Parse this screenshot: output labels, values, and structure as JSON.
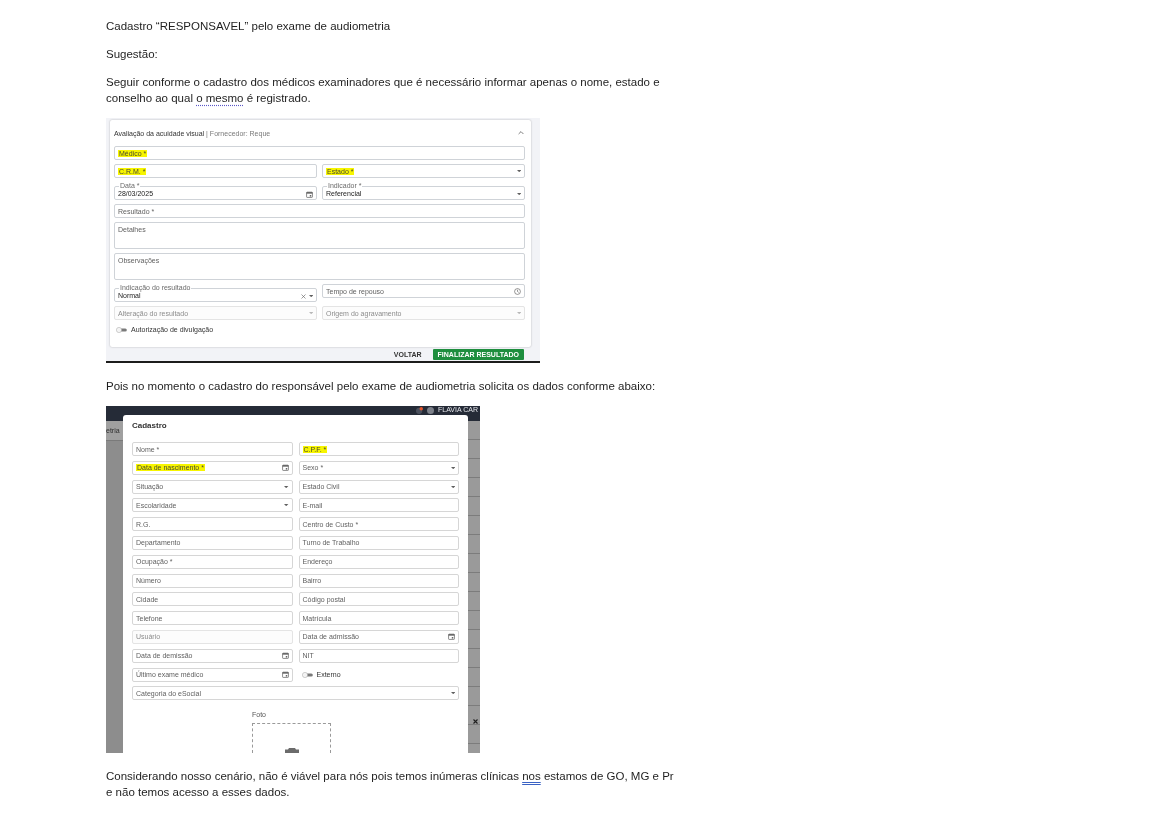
{
  "blocks": [
    {
      "kind": "paragraph",
      "segments": [
        {
          "kind": "plain",
          "text": "Cadastro “RESPONSAVEL” pelo exame de audiometria"
        }
      ]
    },
    {
      "kind": "paragraph",
      "segments": [
        {
          "kind": "plain",
          "text": "Sugestão:"
        }
      ]
    },
    {
      "kind": "paragraph",
      "segments": [
        {
          "kind": "plain",
          "text": "Seguir conforme o cadastro dos médicos examinadores que é necessário informar apenas o nome, estado e conselho ao qual "
        },
        {
          "kind": "dotted_underline",
          "text": "o mesmo"
        },
        {
          "kind": "plain",
          "text": " é registrado."
        }
      ]
    },
    {
      "kind": "exam_form_screenshot",
      "title": "Avaliação da acuidade visual",
      "subtitle": "| Fornecedor: Reque",
      "expanded": true,
      "rows": [
        {
          "fields": [
            {
              "kind": "text",
              "label": "Médico *",
              "highlighted": true,
              "disabled": false,
              "clearable": false
            }
          ]
        },
        {
          "fields": [
            {
              "kind": "text",
              "label": "C.R.M. *",
              "highlighted": true,
              "disabled": false,
              "clearable": false
            },
            {
              "kind": "select",
              "label": "Estado *",
              "highlighted": true,
              "disabled": false,
              "clearable": false
            }
          ]
        },
        {
          "fields": [
            {
              "kind": "date",
              "label": "Data *",
              "value": "28/03/2025",
              "highlighted": false,
              "disabled": false,
              "clearable": false
            },
            {
              "kind": "select",
              "label": "Indicador *",
              "value": "Referencial",
              "highlighted": false,
              "disabled": false,
              "clearable": false
            }
          ]
        },
        {
          "fields": [
            {
              "kind": "text",
              "label": "Resultado *",
              "highlighted": false,
              "disabled": false,
              "clearable": false
            }
          ]
        },
        {
          "fields": [
            {
              "kind": "textarea",
              "label": "Detalhes",
              "highlighted": false,
              "disabled": false,
              "clearable": false
            }
          ]
        },
        {
          "fields": [
            {
              "kind": "textarea",
              "label": "Observações",
              "highlighted": false,
              "disabled": false,
              "clearable": false
            }
          ]
        },
        {
          "fields": [
            {
              "kind": "select",
              "label": "Indicação do resultado",
              "value": "Normal",
              "highlighted": false,
              "disabled": false,
              "clearable": true
            },
            {
              "kind": "time",
              "label": "Tempo de repouso",
              "highlighted": false,
              "disabled": false,
              "clearable": false
            }
          ]
        },
        {
          "fields": [
            {
              "kind": "select",
              "label": "Alteração do resultado",
              "highlighted": false,
              "disabled": true,
              "clearable": false
            },
            {
              "kind": "select",
              "label": "Origem do agravamento",
              "highlighted": false,
              "disabled": true,
              "clearable": false
            }
          ]
        }
      ],
      "switch": {
        "label": "Autorização de divulgação",
        "on": false
      },
      "buttons": [
        {
          "label": "VOLTAR",
          "kind": "text"
        },
        {
          "label": "FINALIZAR RESULTADO",
          "kind": "primary"
        }
      ]
    },
    {
      "kind": "paragraph",
      "segments": [
        {
          "kind": "plain",
          "text": "Pois no momento o cadastro do responsável pelo exame de audiometria solicita os dados conforme abaixo:"
        }
      ]
    },
    {
      "kind": "registration_screenshot",
      "app_bar": {
        "user_name": "FLAVIA CAR"
      },
      "background_tab": "etria",
      "dialog": {
        "title": "Cadastro",
        "rows": [
          {
            "fields": [
              {
                "kind": "text",
                "label": "Nome *",
                "highlighted": false,
                "disabled": false
              },
              {
                "kind": "text",
                "label": "C.P.F. *",
                "highlighted": true,
                "disabled": false
              }
            ]
          },
          {
            "fields": [
              {
                "kind": "date",
                "label": "Data de nascimento *",
                "highlighted": true,
                "disabled": false
              },
              {
                "kind": "select",
                "label": "Sexo *",
                "highlighted": false,
                "disabled": false
              }
            ]
          },
          {
            "fields": [
              {
                "kind": "select",
                "label": "Situação",
                "highlighted": false,
                "disabled": false
              },
              {
                "kind": "select",
                "label": "Estado Civil",
                "highlighted": false,
                "disabled": false
              }
            ]
          },
          {
            "fields": [
              {
                "kind": "select",
                "label": "Escolaridade",
                "highlighted": false,
                "disabled": false
              },
              {
                "kind": "text",
                "label": "E-mail",
                "highlighted": false,
                "disabled": false
              }
            ]
          },
          {
            "fields": [
              {
                "kind": "text",
                "label": "R.G.",
                "highlighted": false,
                "disabled": false
              },
              {
                "kind": "text",
                "label": "Centro de Custo *",
                "highlighted": false,
                "disabled": false
              }
            ]
          },
          {
            "fields": [
              {
                "kind": "text",
                "label": "Departamento",
                "highlighted": false,
                "disabled": false
              },
              {
                "kind": "text",
                "label": "Turno de Trabalho",
                "highlighted": false,
                "disabled": false
              }
            ]
          },
          {
            "fields": [
              {
                "kind": "text",
                "label": "Ocupação *",
                "highlighted": false,
                "disabled": false
              },
              {
                "kind": "text",
                "label": "Endereço",
                "highlighted": false,
                "disabled": false
              }
            ]
          },
          {
            "fields": [
              {
                "kind": "text",
                "label": "Número",
                "highlighted": false,
                "disabled": false
              },
              {
                "kind": "text",
                "label": "Bairro",
                "highlighted": false,
                "disabled": false
              }
            ]
          },
          {
            "fields": [
              {
                "kind": "text",
                "label": "Cidade",
                "highlighted": false,
                "disabled": false
              },
              {
                "kind": "text",
                "label": "Código postal",
                "highlighted": false,
                "disabled": false
              }
            ]
          },
          {
            "fields": [
              {
                "kind": "text",
                "label": "Telefone",
                "highlighted": false,
                "disabled": false
              },
              {
                "kind": "text",
                "label": "Matrícula",
                "highlighted": false,
                "disabled": false
              }
            ]
          },
          {
            "fields": [
              {
                "kind": "text",
                "label": "Usuário",
                "highlighted": false,
                "disabled": true
              },
              {
                "kind": "date",
                "label": "Data de admissão",
                "highlighted": false,
                "disabled": false
              }
            ]
          },
          {
            "fields": [
              {
                "kind": "date",
                "label": "Data de demissão",
                "highlighted": false,
                "disabled": false
              },
              {
                "kind": "text",
                "label": "NIT",
                "highlighted": false,
                "disabled": false
              }
            ]
          },
          {
            "fields": [
              {
                "kind": "date",
                "label": "Último exame médico",
                "highlighted": false,
                "disabled": false
              }
            ],
            "switch": {
              "label": "Externo",
              "on": false
            }
          },
          {
            "fields": [
              {
                "kind": "select",
                "label": "Categoria do eSocial",
                "highlighted": false,
                "disabled": false
              }
            ]
          }
        ],
        "photo_label": "Foto"
      }
    },
    {
      "kind": "paragraph",
      "segments": [
        {
          "kind": "plain",
          "text": "Considerando nosso cenário, não é viável para nós pois temos inúmeras clínicas "
        },
        {
          "kind": "double_underline",
          "text": "nos"
        },
        {
          "kind": "plain",
          "text": " estamos de GO, MG e Pr e não temos acesso a esses dados."
        }
      ]
    }
  ]
}
